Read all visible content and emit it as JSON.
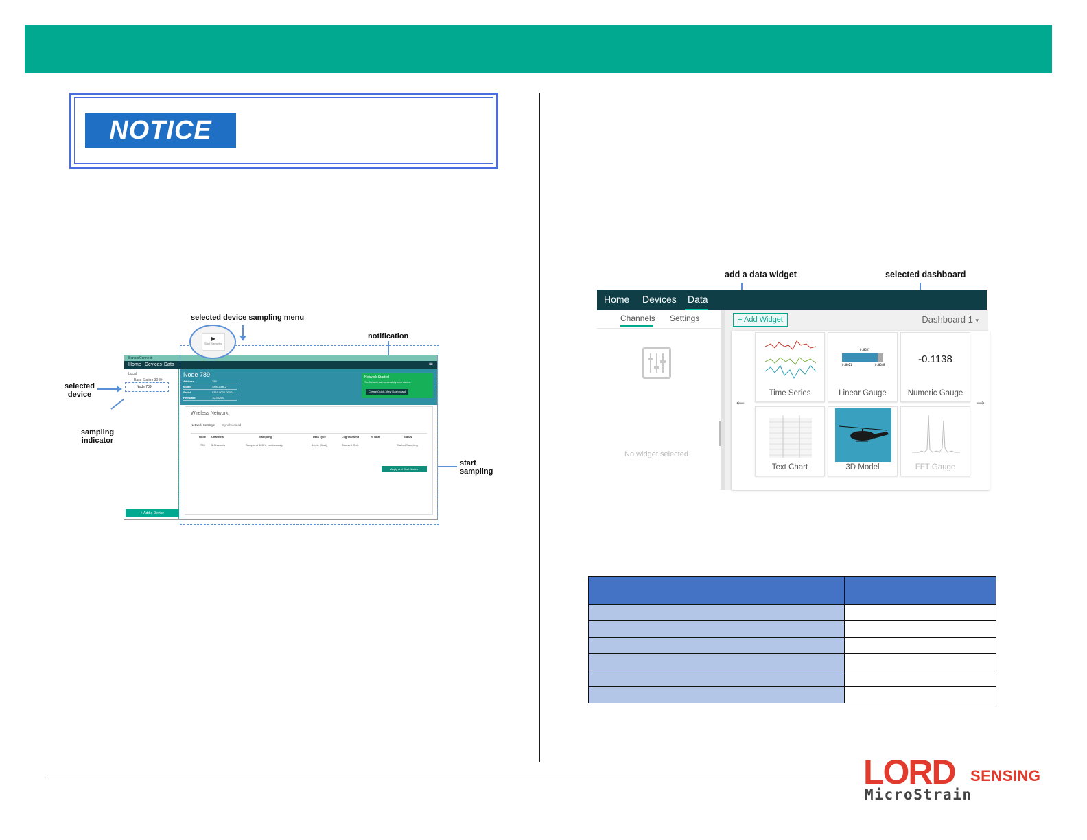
{
  "notice": {
    "label": "NOTICE"
  },
  "left_screenshot": {
    "callouts": {
      "sampling_menu": "selected device sampling menu",
      "notification": "notification",
      "selected_device_line1": "selected",
      "selected_device_line2": "device",
      "sampling_indicator_line1": "sampling",
      "sampling_indicator_line2": "indicator",
      "start_sampling_line1": "start",
      "start_sampling_line2": "sampling"
    },
    "app": {
      "title": "SensorConnect",
      "nav": [
        "Home",
        "Devices",
        "Data"
      ],
      "tree_local": "Local",
      "tree_base_station": "Base Station 30404",
      "tree_node": "Node 789",
      "add_device": "+ Add a Device",
      "node_title": "Node 789",
      "props": [
        {
          "label": "Address",
          "value": "789"
        },
        {
          "label": "Model",
          "value": "SHM-Link-2"
        },
        {
          "label": "Serial",
          "value": "6319-0000-00001"
        },
        {
          "label": "Firmware",
          "value": "10.36268"
        }
      ],
      "notification_title": "Network Started",
      "notification_text": "The Network has successfully been started.",
      "notification_button": "Create Quick-View Dashboard",
      "section_title": "Wireless Network",
      "network_settings": "Network Settings:",
      "sync_label": "Synchronized",
      "table_headers": [
        "Node",
        "Channels",
        "Sampling",
        "Data Type",
        "Log/Transmit",
        "% Total",
        "Status"
      ],
      "table_row": [
        "789",
        "3 Channels",
        "Sample at 128Hz continuously",
        "4-byte (float)",
        "Transmit Only",
        "",
        "Started Sampling"
      ],
      "apply_button": "Apply and Start Nodes",
      "start_sampling_tile": "Start Sampling"
    }
  },
  "right_screenshot": {
    "callouts": {
      "add_widget": "add a data widget",
      "selected_dashboard": "selected dashboard"
    },
    "nav": [
      "Home",
      "Devices",
      "Data"
    ],
    "tabs": [
      "Channels",
      "Settings"
    ],
    "no_widget": "No widget selected",
    "add_widget_button": "+ Add Widget",
    "dashboard_select": "Dashboard 1",
    "tiles": [
      {
        "label": "Time Series"
      },
      {
        "label": "Linear Gauge"
      },
      {
        "label": "Numeric Gauge"
      },
      {
        "label": "Text Chart"
      },
      {
        "label": "3D Model"
      },
      {
        "label": "FFT Gauge"
      }
    ],
    "numeric_value": "-0.1138",
    "linear_gauge": {
      "top": "0.0657",
      "min": "0.0021",
      "max": "0.0648"
    }
  },
  "table": {
    "rows": 6
  },
  "logo": {
    "brand": "LORD",
    "sensing": "SENSING",
    "sub": "MicroStrain"
  },
  "colors": {
    "header": "#00a98f",
    "notice_blue": "#1f6fc4",
    "table_header": "#4472c4",
    "table_cell": "#b4c6e7",
    "logo_red": "#e23b2e"
  }
}
